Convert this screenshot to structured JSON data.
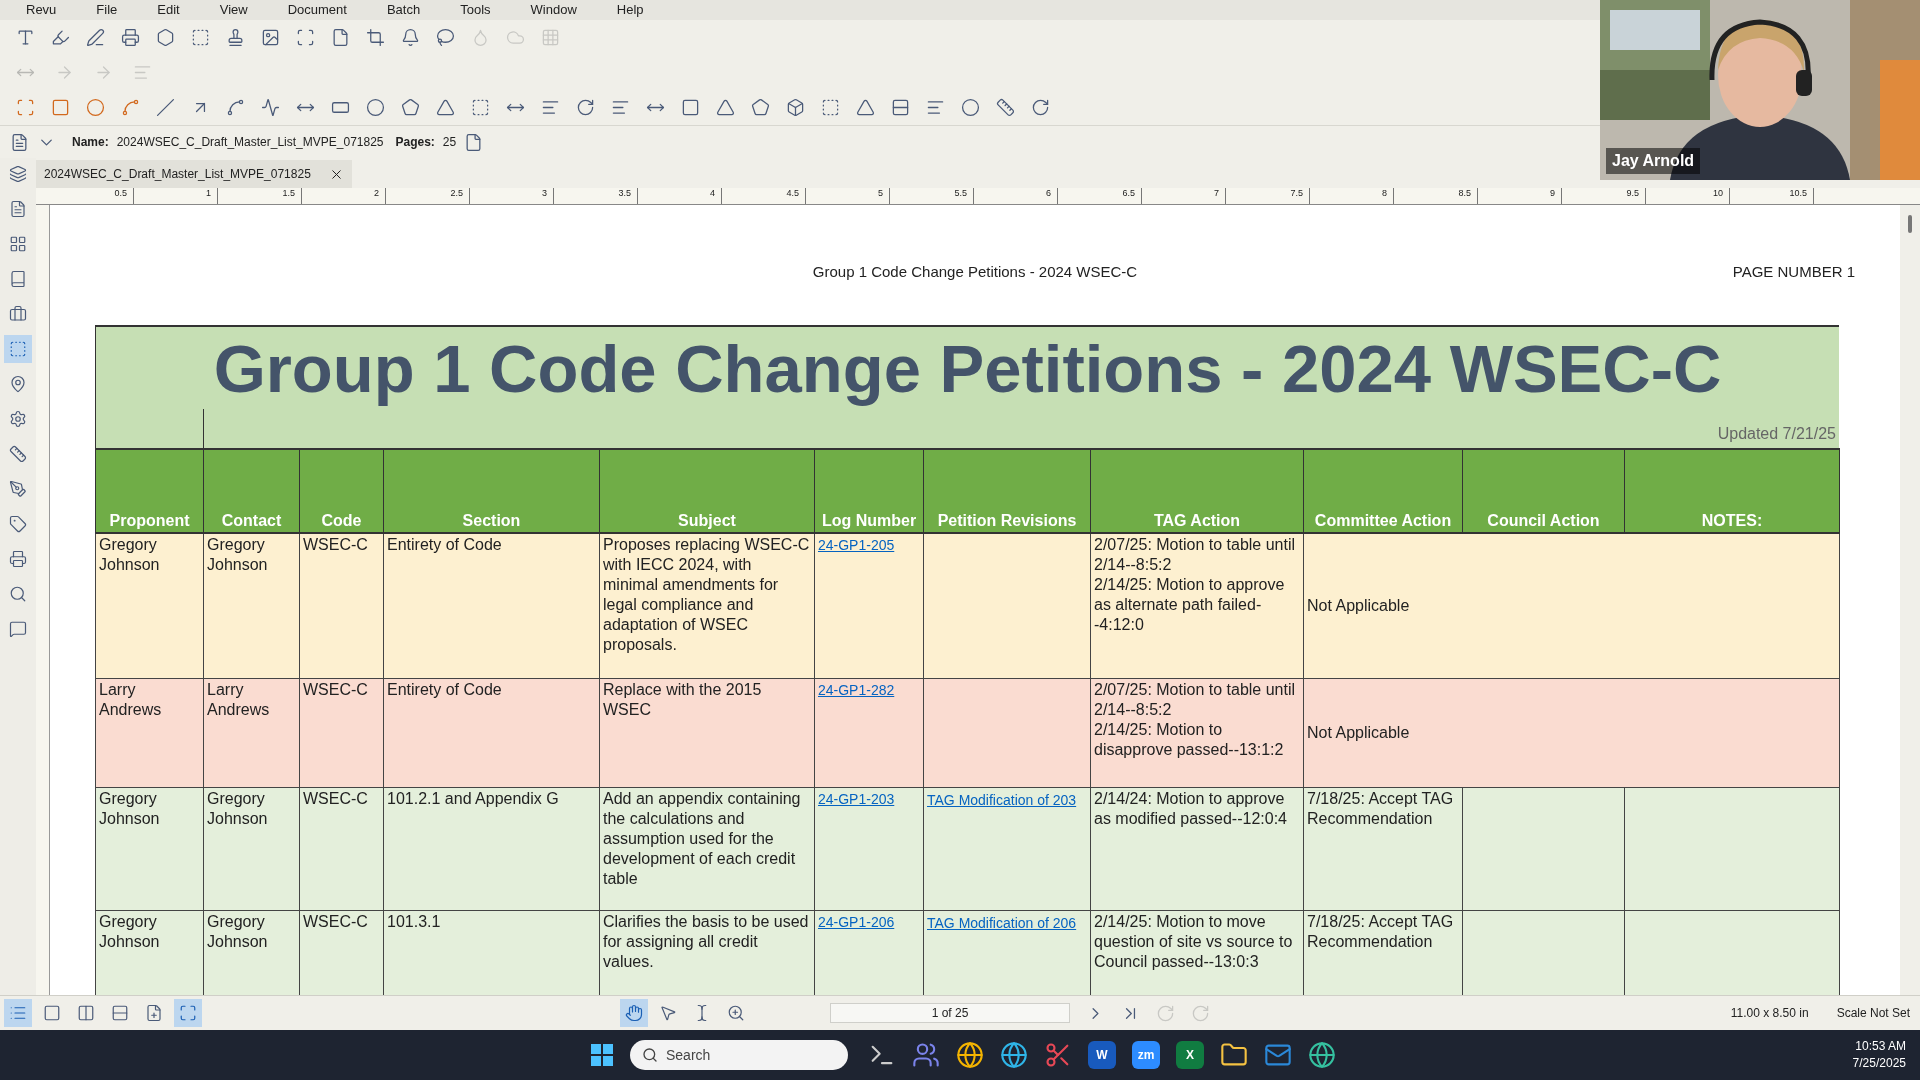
{
  "menu": [
    "Revu",
    "File",
    "Edit",
    "View",
    "Document",
    "Batch",
    "Tools",
    "Window",
    "Help"
  ],
  "document_bar": {
    "name_label": "Name:",
    "name": "2024WSEC_C_Draft_Master_List_MVPE_071825",
    "pages_label": "Pages:",
    "pages": "25"
  },
  "sidebar_tools": [
    {
      "kind": "layers",
      "selected": false
    },
    {
      "kind": "file",
      "selected": false
    },
    {
      "kind": "grid",
      "selected": false
    },
    {
      "kind": "book",
      "selected": false
    },
    {
      "kind": "briefcase",
      "selected": false
    },
    {
      "kind": "select",
      "selected": true
    },
    {
      "kind": "pin",
      "selected": false
    },
    {
      "kind": "settings",
      "selected": false
    },
    {
      "kind": "ruler",
      "selected": false
    },
    {
      "kind": "pen",
      "selected": false
    },
    {
      "kind": "tag",
      "selected": false
    },
    {
      "kind": "printer",
      "selected": false
    },
    {
      "kind": "search",
      "selected": false
    },
    {
      "kind": "comment",
      "selected": false
    }
  ],
  "tabs": [
    {
      "label": "2024WSEC_C_Draft_Master_List_MVPE_071825",
      "selected": true
    }
  ],
  "ruler": [
    "0.5",
    "1",
    "1.5",
    "2",
    "2.5",
    "3",
    "3.5",
    "4",
    "4.5",
    "5",
    "5.5",
    "6",
    "6.5",
    "7",
    "7.5",
    "8",
    "8.5",
    "9",
    "9.5",
    "10",
    "10.5"
  ],
  "page": {
    "header": "Group 1 Code Change Petitions - 2024 WSEC-C",
    "page_number": "PAGE NUMBER 1",
    "title": "Group 1 Code Change Petitions - 2024 WSEC-C",
    "updated": "Updated 7/21/25",
    "columns": [
      "Proponent",
      "Contact",
      "Code",
      "Section",
      "Subject",
      "Log Number",
      "Petition Revisions",
      "TAG Action",
      "Committee Action",
      "Council Action",
      "NOTES:"
    ],
    "rows": [
      {
        "kind": "merged",
        "color": "#fdf0d0",
        "proponent": "Gregory Johnson",
        "contact": "Gregory Johnson",
        "code": "WSEC-C",
        "section": "Entirety of Code",
        "subject": "Proposes replacing WSEC-C with IECC 2024, with minimal amendments for legal compliance and adaptation of WSEC proposals.",
        "log_number": "24-GP1-205",
        "tag_action": [
          "2/07/25: Motion to table until 2/14--8:5:2",
          "2/14/25: Motion to approve as alternate path failed--4:12:0"
        ],
        "committee_action": "Not Applicable"
      },
      {
        "kind": "merged",
        "color": "#fadcd1",
        "proponent": "Larry Andrews",
        "contact": "Larry Andrews",
        "code": "WSEC-C",
        "section": "Entirety of Code",
        "subject": "Replace with the 2015 WSEC",
        "log_number": "24-GP1-282",
        "tag_action": [
          "2/07/25: Motion to table until 2/14--8:5:2",
          "2/14/25: Motion to disapprove passed--13:1:2"
        ],
        "committee_action": "Not Applicable"
      },
      {
        "kind": "split",
        "color": "#e4efdb",
        "proponent": "Gregory Johnson",
        "contact": "Gregory Johnson",
        "code": "WSEC-C",
        "section": "101.2.1 and Appendix G",
        "subject": "Add an appendix containing the calculations and assumption used for the development of each credit table",
        "log_number": "24-GP1-203",
        "petition_revisions": [
          "TAG Modification of 203"
        ],
        "tag_action": [
          "2/14/24: Motion to approve as modified passed--12:0:4"
        ],
        "committee_action": "7/18/25: Accept TAG Recommendation"
      },
      {
        "kind": "split",
        "color": "#e4efdb",
        "proponent": "Gregory Johnson",
        "contact": "Gregory Johnson",
        "code": "WSEC-C",
        "section": "101.3.1",
        "subject": "Clarifies the basis to be used for assigning all credit values.",
        "log_number": "24-GP1-206",
        "petition_revisions": [
          "TAG Modification of 206"
        ],
        "tag_action": [
          "2/14/25: Motion to move question of site vs source to Council passed--13:0:3"
        ],
        "committee_action": "7/18/25: Accept TAG Recommendation"
      }
    ]
  },
  "view_tools": [
    {
      "kind": "list",
      "selected": true
    },
    {
      "kind": "single",
      "selected": false
    },
    {
      "kind": "columns",
      "selected": false
    },
    {
      "kind": "rows",
      "selected": false
    },
    {
      "kind": "add",
      "selected": false
    },
    {
      "kind": "fit",
      "selected": true
    }
  ],
  "bottom_tools": [
    {
      "kind": "hand",
      "selected": true
    },
    {
      "kind": "pointer",
      "selected": false
    },
    {
      "kind": "text",
      "selected": false
    },
    {
      "kind": "zoom",
      "selected": false
    }
  ],
  "status_bar": {
    "page_field": "1 of 25",
    "size": "11.00 x 8.50 in",
    "scale": "Scale Not Set"
  },
  "video": {
    "name": "Jay Arnold"
  },
  "taskbar": {
    "search_placeholder": "Search",
    "apps": [
      {
        "kind": "terminal"
      },
      {
        "kind": "chat"
      },
      {
        "kind": "browser"
      },
      {
        "kind": "edge"
      },
      {
        "kind": "snip"
      },
      {
        "kind": "letter",
        "label": "W",
        "color": "#185abd"
      },
      {
        "kind": "letter",
        "label": "zm",
        "color": "#2d8cff"
      },
      {
        "kind": "letter",
        "label": "X",
        "color": "#107c41"
      },
      {
        "kind": "folder"
      },
      {
        "kind": "mail"
      },
      {
        "kind": "globe"
      }
    ],
    "time": "10:53 AM",
    "date": "7/25/2025"
  }
}
